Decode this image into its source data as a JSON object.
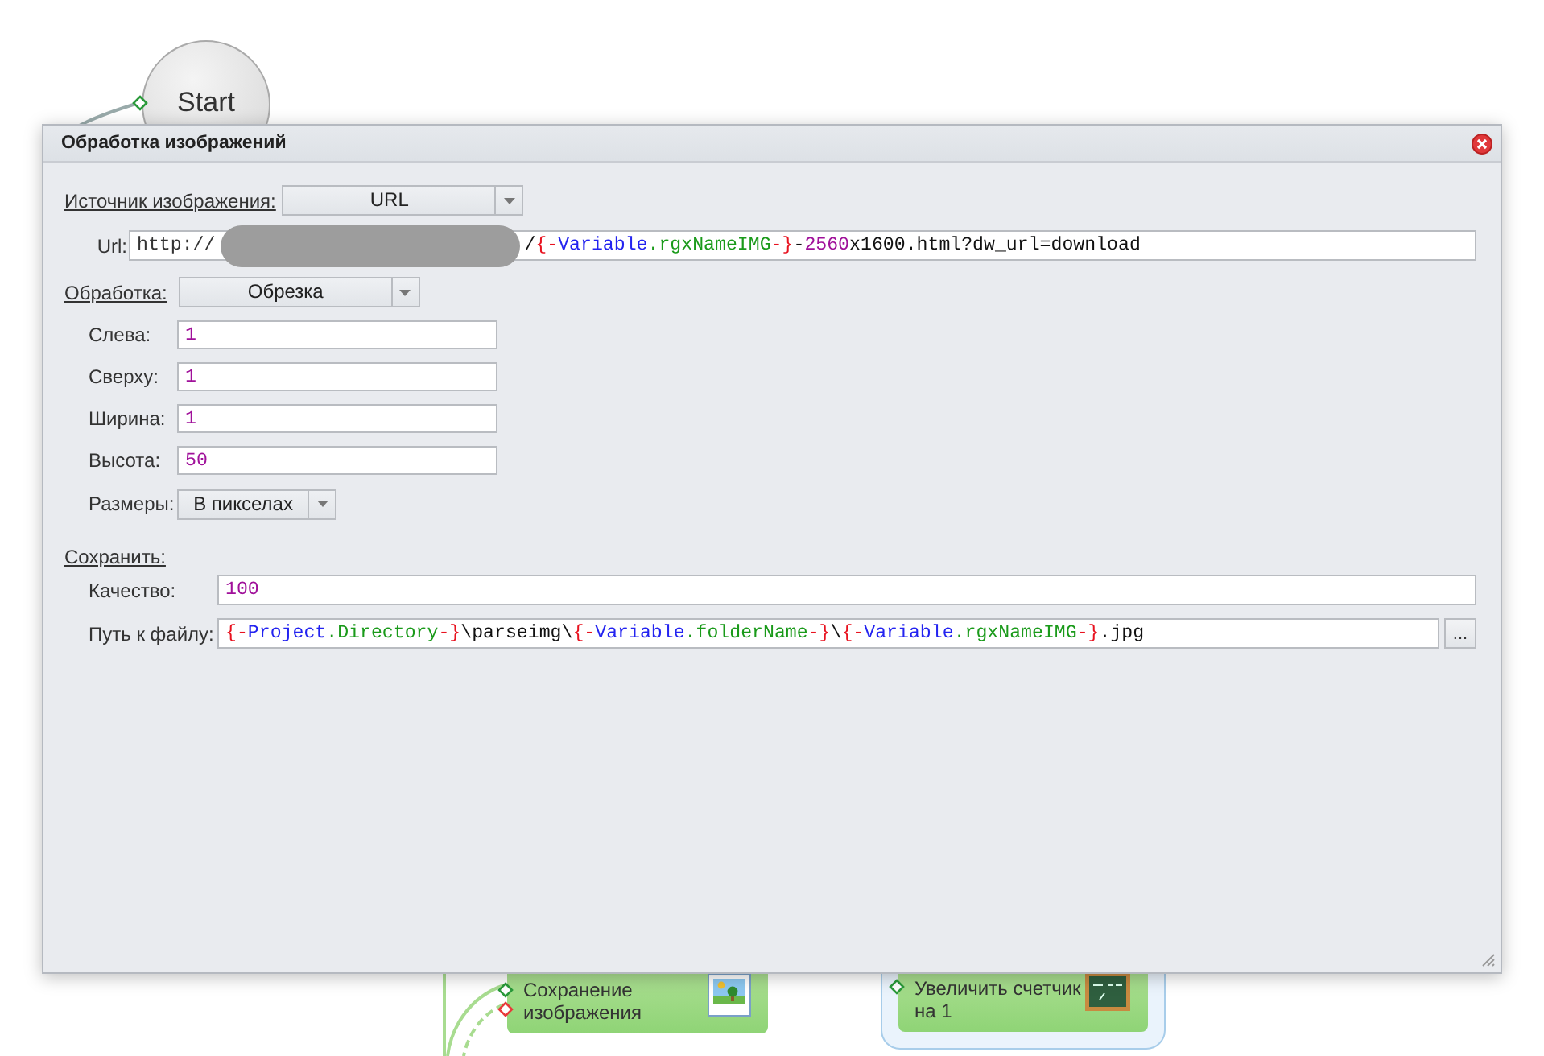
{
  "canvas": {
    "start_node": "Start",
    "nodes": [
      {
        "kind": "image",
        "selected": false,
        "lines": [
          "Сохранение",
          "изображения"
        ]
      },
      {
        "kind": "counter",
        "selected": true,
        "lines": [
          "Увеличить счетчик",
          "на 1"
        ]
      }
    ]
  },
  "dialog": {
    "title": "Обработка изображений",
    "source": {
      "label": "Источник изображения:",
      "value": "URL"
    },
    "url": {
      "label": "Url:",
      "start": "http://",
      "tokens": [
        {
          "text": "/",
          "kind": "plain"
        },
        {
          "text": "{-",
          "kind": "brace"
        },
        {
          "text": "Variable",
          "kind": "object"
        },
        {
          "text": ".rgxNameIMG",
          "kind": "property"
        },
        {
          "text": "-}",
          "kind": "brace"
        },
        {
          "text": "-",
          "kind": "plain"
        },
        {
          "text": "2560",
          "kind": "number"
        },
        {
          "text": "x1600.html?dw_url=download",
          "kind": "plain"
        }
      ]
    },
    "processing": {
      "label": "Обработка:",
      "value": "Обрезка"
    },
    "params": [
      {
        "label": "Слева:",
        "tokens": [
          {
            "text": "1",
            "kind": "number"
          }
        ]
      },
      {
        "label": "Сверху:",
        "tokens": [
          {
            "text": "1",
            "kind": "number"
          }
        ]
      },
      {
        "label": "Ширина:",
        "tokens": [
          {
            "text": "1",
            "kind": "number"
          }
        ]
      },
      {
        "label": "Высота:",
        "tokens": [
          {
            "text": "50",
            "kind": "number"
          }
        ]
      }
    ],
    "size": {
      "label": "Размеры:",
      "value": "В пикселах"
    },
    "save": {
      "label": "Сохранить:"
    },
    "quality": {
      "label": "Качество:",
      "tokens": [
        {
          "text": "100",
          "kind": "number"
        }
      ]
    },
    "path": {
      "label": "Путь к файлу:",
      "browse": "...",
      "tokens": [
        {
          "text": "{-",
          "kind": "brace"
        },
        {
          "text": "Project",
          "kind": "object"
        },
        {
          "text": ".Directory",
          "kind": "property"
        },
        {
          "text": "-}",
          "kind": "brace"
        },
        {
          "text": "\\parseimg\\",
          "kind": "plain"
        },
        {
          "text": "{-",
          "kind": "brace"
        },
        {
          "text": "Variable",
          "kind": "object"
        },
        {
          "text": ".folderName",
          "kind": "property"
        },
        {
          "text": "-}",
          "kind": "brace"
        },
        {
          "text": "\\",
          "kind": "plain"
        },
        {
          "text": "{-",
          "kind": "brace"
        },
        {
          "text": "Variable",
          "kind": "object"
        },
        {
          "text": ".rgxNameIMG",
          "kind": "property"
        },
        {
          "text": "-}",
          "kind": "brace"
        },
        {
          "text": ".jpg",
          "kind": "plain"
        }
      ]
    }
  }
}
